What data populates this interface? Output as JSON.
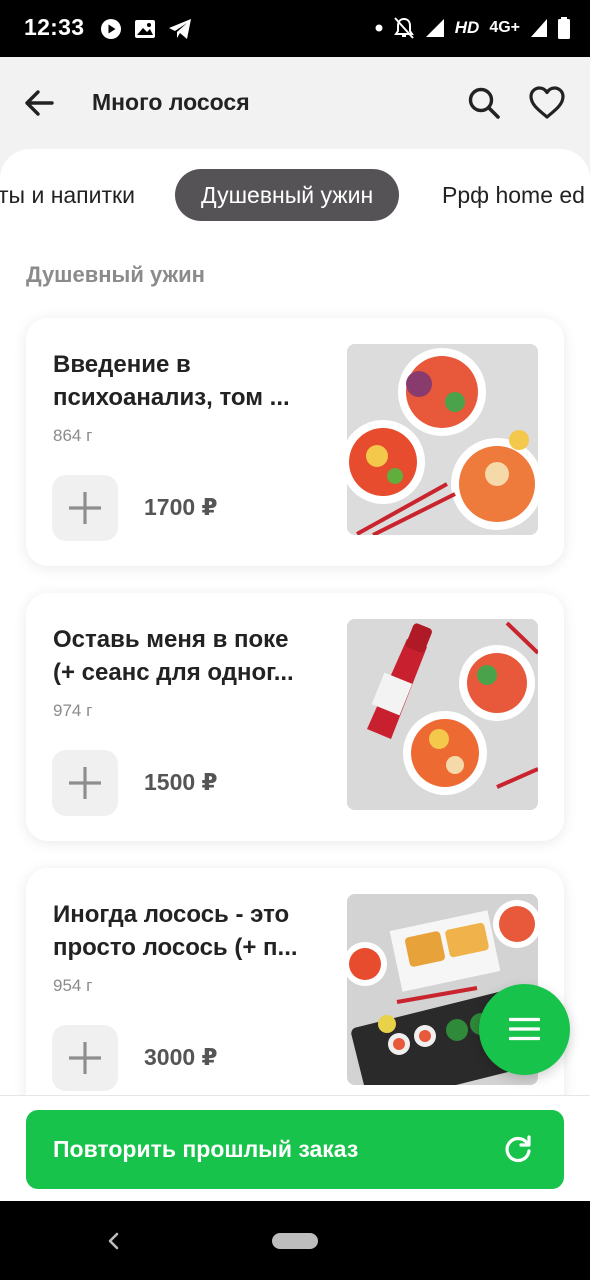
{
  "status_bar": {
    "time": "12:33",
    "network_label": "HD",
    "network_type": "4G+"
  },
  "header": {
    "title": "Много лосося",
    "back_icon": "arrow-left-icon",
    "search_icon": "search-icon",
    "favorite_icon": "heart-icon"
  },
  "tabs": [
    {
      "label": "ты и напитки",
      "active": false
    },
    {
      "label": "Душевный ужин",
      "active": true
    },
    {
      "label": "Ррф home ed",
      "active": false
    }
  ],
  "section": {
    "title": "Душевный ужин"
  },
  "products": [
    {
      "name_line1": "Введение в",
      "name_line2": "психоанализ, том ...",
      "weight": "864 г",
      "price": "1700 ₽"
    },
    {
      "name_line1": "Оставь меня в поке",
      "name_line2": "(+ сеанс для одног...",
      "weight": "974 г",
      "price": "1500 ₽"
    },
    {
      "name_line1": "Иногда лосось - это",
      "name_line2": "просто лосось (+ п...",
      "weight": "954 г",
      "price": "3000 ₽"
    }
  ],
  "fab": {
    "icon": "menu-icon"
  },
  "bottom": {
    "repeat_label": "Повторить прошлый заказ",
    "repeat_icon": "refresh-icon"
  },
  "colors": {
    "accent_green": "#18c34b",
    "active_tab_bg": "#555355",
    "muted_text": "#8b8b8b"
  }
}
